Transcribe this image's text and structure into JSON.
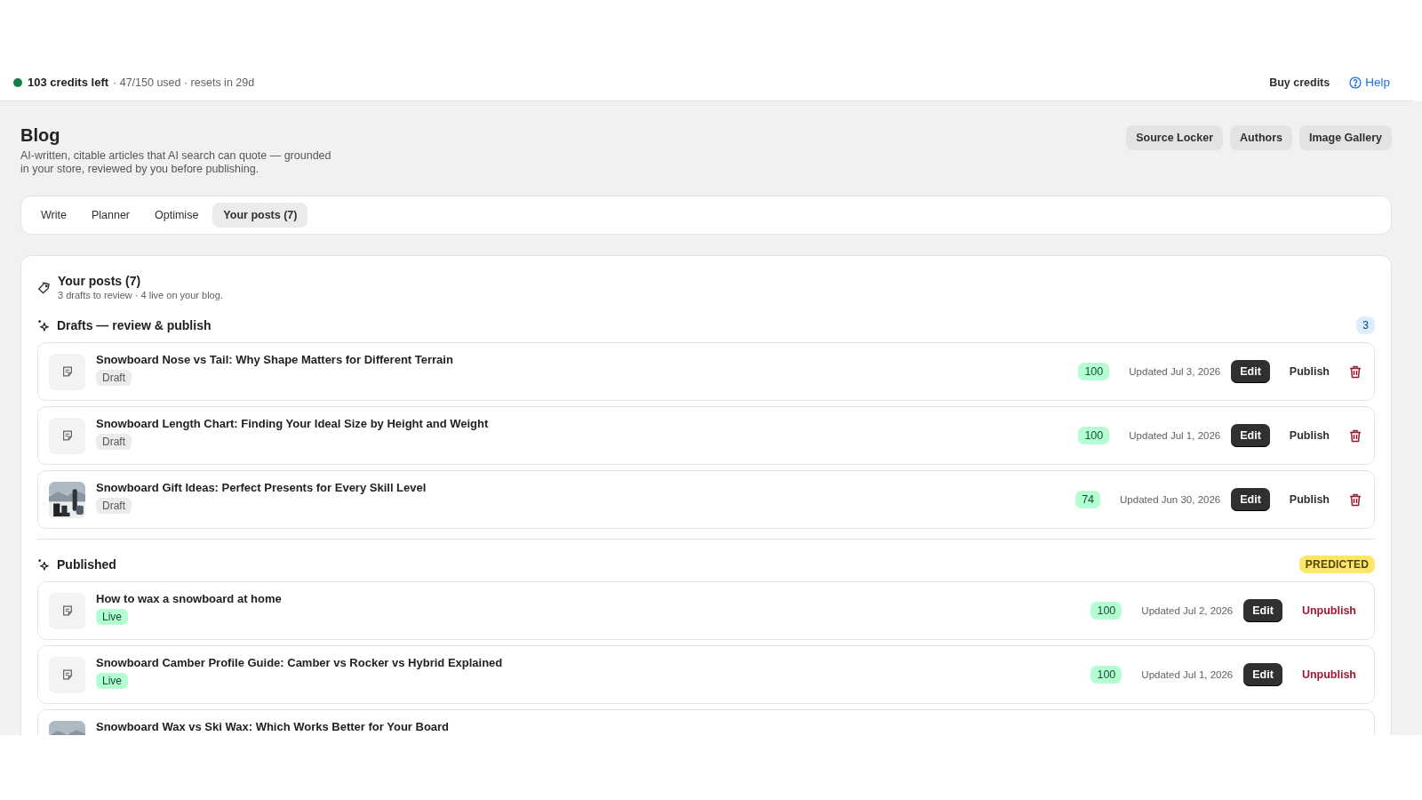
{
  "credits": {
    "color": "#108043",
    "headline": "103 credits left",
    "detail": "· 47/150 used · resets in 29d"
  },
  "top_links": [
    {
      "label": "Buy credits",
      "kind": "plain"
    },
    {
      "label": "Help",
      "kind": "help"
    }
  ],
  "page": {
    "title": "Blog",
    "subtitle": "AI-written, citable articles that AI search can quote — grounded in your store, reviewed by you before publishing.",
    "buttons": [
      "Source Locker",
      "Authors",
      "Image Gallery"
    ]
  },
  "tabs": [
    {
      "label": "Write",
      "selected": false
    },
    {
      "label": "Planner",
      "selected": false
    },
    {
      "label": "Optimise",
      "selected": false
    },
    {
      "label": "Your posts (7)",
      "selected": true
    }
  ],
  "panel": {
    "title": "Your posts (7)",
    "subtitle": "3 drafts to review · 4 live on your blog."
  },
  "sections": [
    {
      "title": "Drafts — review & publish",
      "badge": {
        "text": "3",
        "kind": "count"
      },
      "posts": [
        {
          "kind": "draft",
          "thumbnail": {
            "kind": "icon"
          },
          "title": "Snowboard Nose vs Tail: Why Shape Matters for Different Terrain",
          "status": "Draft",
          "score": "100",
          "updated": "Updated Jul 3, 2026",
          "edit": "Edit",
          "action": "Publish",
          "deletable": true
        },
        {
          "kind": "draft",
          "thumbnail": {
            "kind": "icon"
          },
          "title": "Snowboard Length Chart: Finding Your Ideal Size by Height and Weight",
          "status": "Draft",
          "score": "100",
          "updated": "Updated Jul 1, 2026",
          "edit": "Edit",
          "action": "Publish",
          "deletable": true
        },
        {
          "kind": "draft",
          "title": "Snowboard Gift Ideas: Perfect Presents for Every Skill Level",
          "status": "Draft",
          "score": "74",
          "updated": "Updated Jun 30, 2026",
          "edit": "Edit",
          "action": "Publish",
          "deletable": true
        }
      ]
    },
    {
      "title": "Published",
      "badge": {
        "text": "PREDICTED",
        "kind": "predicted"
      },
      "posts": [
        {
          "kind": "live",
          "thumbnail": {
            "kind": "icon"
          },
          "title": "How to wax a snowboard at home",
          "status": "Live",
          "score": "100",
          "updated": "Updated Jul 2, 2026",
          "edit": "Edit",
          "action": "Unpublish",
          "deletable": false
        },
        {
          "kind": "live",
          "thumbnail": {
            "kind": "icon"
          },
          "title": "Snowboard Camber Profile Guide: Camber vs Rocker vs Hybrid Explained",
          "status": "Live",
          "score": "100",
          "updated": "Updated Jul 1, 2026",
          "edit": "Edit",
          "action": "Unpublish",
          "deletable": false
        },
        {
          "kind": "live",
          "title": "Snowboard Wax vs Ski Wax: Which Works Better for Your Board",
          "deletable": false
        }
      ]
    }
  ]
}
